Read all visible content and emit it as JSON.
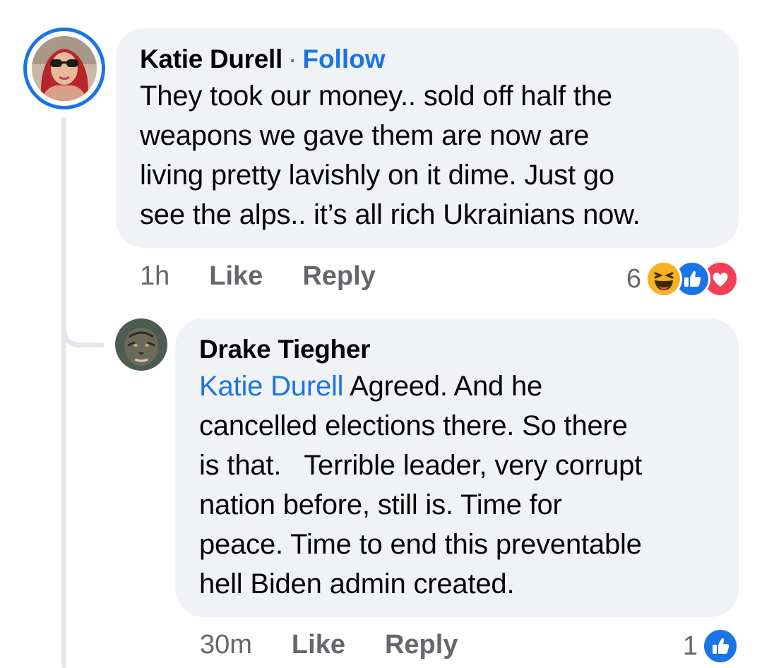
{
  "comments": [
    {
      "author": "Katie Durell",
      "follow_label": "Follow",
      "separator": "·",
      "body": "They took our money.. sold off half the\nweapons we gave them are now are\nliving pretty lavishly on it dime. Just go\nsee the alps.. it’s all rich Ukrainians now.",
      "time": "1h",
      "like_label": "Like",
      "reply_label": "Reply",
      "reaction_count": "6",
      "reactions": [
        "haha-icon",
        "like-icon",
        "love-icon"
      ]
    },
    {
      "author": "Drake Tiegher",
      "mention": "Katie Durell",
      "body": " Agreed. And he\ncancelled elections there. So there\nis that.   Terrible leader, very corrupt\nnation before, still is. Time for\npeace. Time to end this preventable\nhell Biden admin created.",
      "time": "30m",
      "like_label": "Like",
      "reply_label": "Reply",
      "reaction_count": "1",
      "reactions": [
        "like-icon"
      ]
    }
  ],
  "colors": {
    "accent": "#1b74e4",
    "bubble": "#f0f2f5",
    "secondary_text": "#65676b",
    "haha": "#f7b125",
    "love": "#f33e58"
  }
}
